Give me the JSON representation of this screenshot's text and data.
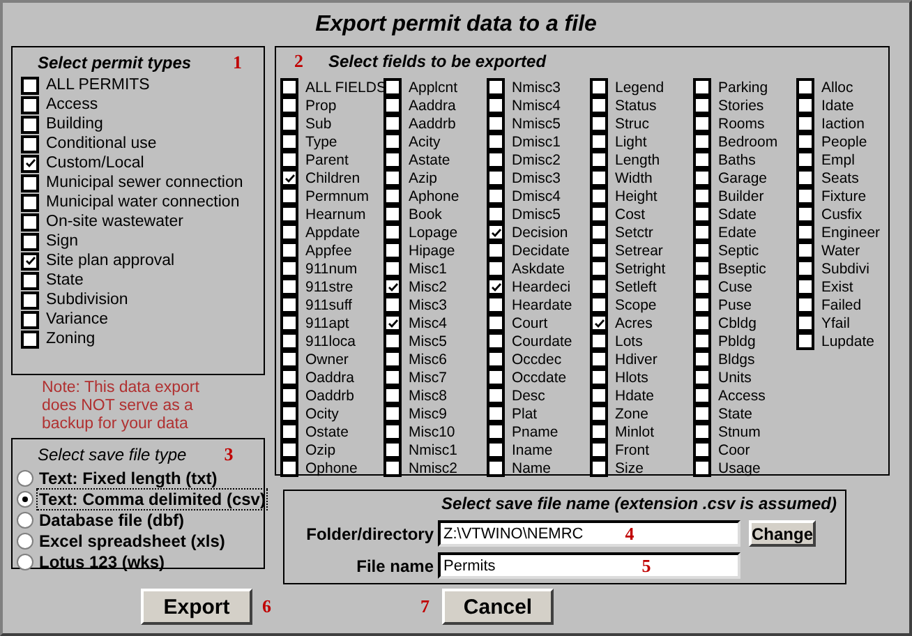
{
  "window": {
    "title": "Export permit data to a file"
  },
  "permit_types": {
    "title": "Select permit types",
    "marker": "1",
    "items": [
      {
        "label": "ALL PERMITS",
        "checked": false
      },
      {
        "label": "Access",
        "checked": false
      },
      {
        "label": "Building",
        "checked": false
      },
      {
        "label": "Conditional use",
        "checked": false
      },
      {
        "label": "Custom/Local",
        "checked": true
      },
      {
        "label": "Municipal sewer connection",
        "checked": false
      },
      {
        "label": "Municipal water connection",
        "checked": false
      },
      {
        "label": "On-site wastewater",
        "checked": false
      },
      {
        "label": "Sign",
        "checked": false
      },
      {
        "label": "Site plan approval",
        "checked": true
      },
      {
        "label": "State",
        "checked": false
      },
      {
        "label": "Subdivision",
        "checked": false
      },
      {
        "label": "Variance",
        "checked": false
      },
      {
        "label": "Zoning",
        "checked": false
      }
    ]
  },
  "note": "Note: This data export does NOT serve as a backup for your data",
  "file_type": {
    "title": "Select save file type",
    "marker": "3",
    "options": [
      {
        "label": "Text: Fixed length (txt)",
        "selected": false,
        "focused": false
      },
      {
        "label": "Text: Comma delimited (csv)",
        "selected": true,
        "focused": true
      },
      {
        "label": "Database file (dbf)",
        "selected": false,
        "focused": false
      },
      {
        "label": "Excel spreadsheet (xls)",
        "selected": false,
        "focused": false
      },
      {
        "label": "Lotus 123 (wks)",
        "selected": false,
        "focused": false
      }
    ]
  },
  "fields": {
    "title": "Select fields to be exported",
    "marker": "2",
    "columns": [
      {
        "items": [
          {
            "label": "ALL FIELDS",
            "checked": false
          },
          {
            "label": "Prop",
            "checked": false
          },
          {
            "label": "Sub",
            "checked": false
          },
          {
            "label": "Type",
            "checked": false
          },
          {
            "label": "Parent",
            "checked": false
          },
          {
            "label": "Children",
            "checked": true
          },
          {
            "label": "Permnum",
            "checked": false
          },
          {
            "label": "Hearnum",
            "checked": false
          },
          {
            "label": "Appdate",
            "checked": false
          },
          {
            "label": "Appfee",
            "checked": false
          },
          {
            "label": "911num",
            "checked": false
          },
          {
            "label": "911stre",
            "checked": false
          },
          {
            "label": "911suff",
            "checked": false
          },
          {
            "label": "911apt",
            "checked": false
          },
          {
            "label": "911loca",
            "checked": false
          },
          {
            "label": "Owner",
            "checked": false
          },
          {
            "label": "Oaddra",
            "checked": false
          },
          {
            "label": "Oaddrb",
            "checked": false
          },
          {
            "label": "Ocity",
            "checked": false
          },
          {
            "label": "Ostate",
            "checked": false
          },
          {
            "label": "Ozip",
            "checked": false
          },
          {
            "label": "Ophone",
            "checked": false
          }
        ]
      },
      {
        "items": [
          {
            "label": "Applcnt",
            "checked": false
          },
          {
            "label": "Aaddra",
            "checked": false
          },
          {
            "label": "Aaddrb",
            "checked": false
          },
          {
            "label": "Acity",
            "checked": false
          },
          {
            "label": "Astate",
            "checked": false
          },
          {
            "label": "Azip",
            "checked": false
          },
          {
            "label": "Aphone",
            "checked": false
          },
          {
            "label": "Book",
            "checked": false
          },
          {
            "label": "Lopage",
            "checked": false
          },
          {
            "label": "Hipage",
            "checked": false
          },
          {
            "label": "Misc1",
            "checked": false
          },
          {
            "label": "Misc2",
            "checked": true
          },
          {
            "label": "Misc3",
            "checked": false
          },
          {
            "label": "Misc4",
            "checked": true
          },
          {
            "label": "Misc5",
            "checked": false
          },
          {
            "label": "Misc6",
            "checked": false
          },
          {
            "label": "Misc7",
            "checked": false
          },
          {
            "label": "Misc8",
            "checked": false
          },
          {
            "label": "Misc9",
            "checked": false
          },
          {
            "label": "Misc10",
            "checked": false
          },
          {
            "label": "Nmisc1",
            "checked": false
          },
          {
            "label": "Nmisc2",
            "checked": false
          }
        ]
      },
      {
        "items": [
          {
            "label": "Nmisc3",
            "checked": false
          },
          {
            "label": "Nmisc4",
            "checked": false
          },
          {
            "label": "Nmisc5",
            "checked": false
          },
          {
            "label": "Dmisc1",
            "checked": false
          },
          {
            "label": "Dmisc2",
            "checked": false
          },
          {
            "label": "Dmisc3",
            "checked": false
          },
          {
            "label": "Dmisc4",
            "checked": false
          },
          {
            "label": "Dmisc5",
            "checked": false
          },
          {
            "label": "Decision",
            "checked": true
          },
          {
            "label": "Decidate",
            "checked": false
          },
          {
            "label": "Askdate",
            "checked": false
          },
          {
            "label": "Heardeci",
            "checked": true
          },
          {
            "label": "Heardate",
            "checked": false
          },
          {
            "label": "Court",
            "checked": false
          },
          {
            "label": "Courdate",
            "checked": false
          },
          {
            "label": "Occdec",
            "checked": false
          },
          {
            "label": "Occdate",
            "checked": false
          },
          {
            "label": "Desc",
            "checked": false
          },
          {
            "label": "Plat",
            "checked": false
          },
          {
            "label": "Pname",
            "checked": false
          },
          {
            "label": "Iname",
            "checked": false
          },
          {
            "label": "Name",
            "checked": false
          }
        ]
      },
      {
        "items": [
          {
            "label": "Legend",
            "checked": false
          },
          {
            "label": "Status",
            "checked": false
          },
          {
            "label": "Struc",
            "checked": false
          },
          {
            "label": "Light",
            "checked": false
          },
          {
            "label": "Length",
            "checked": false
          },
          {
            "label": "Width",
            "checked": false
          },
          {
            "label": "Height",
            "checked": false
          },
          {
            "label": "Cost",
            "checked": false
          },
          {
            "label": "Setctr",
            "checked": false
          },
          {
            "label": "Setrear",
            "checked": false
          },
          {
            "label": "Setright",
            "checked": false
          },
          {
            "label": "Setleft",
            "checked": false
          },
          {
            "label": "Scope",
            "checked": false
          },
          {
            "label": "Acres",
            "checked": true
          },
          {
            "label": "Lots",
            "checked": false
          },
          {
            "label": "Hdiver",
            "checked": false
          },
          {
            "label": "Hlots",
            "checked": false
          },
          {
            "label": "Hdate",
            "checked": false
          },
          {
            "label": "Zone",
            "checked": false
          },
          {
            "label": "Minlot",
            "checked": false
          },
          {
            "label": "Front",
            "checked": false
          },
          {
            "label": "Size",
            "checked": false
          }
        ]
      },
      {
        "items": [
          {
            "label": "Parking",
            "checked": false
          },
          {
            "label": "Stories",
            "checked": false
          },
          {
            "label": "Rooms",
            "checked": false
          },
          {
            "label": "Bedroom",
            "checked": false
          },
          {
            "label": "Baths",
            "checked": false
          },
          {
            "label": "Garage",
            "checked": false
          },
          {
            "label": "Builder",
            "checked": false
          },
          {
            "label": "Sdate",
            "checked": false
          },
          {
            "label": "Edate",
            "checked": false
          },
          {
            "label": "Septic",
            "checked": false
          },
          {
            "label": "Bseptic",
            "checked": false
          },
          {
            "label": "Cuse",
            "checked": false
          },
          {
            "label": "Puse",
            "checked": false
          },
          {
            "label": "Cbldg",
            "checked": false
          },
          {
            "label": "Pbldg",
            "checked": false
          },
          {
            "label": "Bldgs",
            "checked": false
          },
          {
            "label": "Units",
            "checked": false
          },
          {
            "label": "Access",
            "checked": false
          },
          {
            "label": "State",
            "checked": false
          },
          {
            "label": "Stnum",
            "checked": false
          },
          {
            "label": "Coor",
            "checked": false
          },
          {
            "label": "Usage",
            "checked": false
          }
        ]
      },
      {
        "items": [
          {
            "label": "Alloc",
            "checked": false
          },
          {
            "label": "Idate",
            "checked": false
          },
          {
            "label": "Iaction",
            "checked": false
          },
          {
            "label": "People",
            "checked": false
          },
          {
            "label": "Empl",
            "checked": false
          },
          {
            "label": "Seats",
            "checked": false
          },
          {
            "label": "Fixture",
            "checked": false
          },
          {
            "label": "Cusfix",
            "checked": false
          },
          {
            "label": "Engineer",
            "checked": false
          },
          {
            "label": "Water",
            "checked": false
          },
          {
            "label": "Subdivi",
            "checked": false
          },
          {
            "label": "Exist",
            "checked": false
          },
          {
            "label": "Failed",
            "checked": false
          },
          {
            "label": "Yfail",
            "checked": false
          },
          {
            "label": "Lupdate",
            "checked": false
          }
        ]
      }
    ]
  },
  "save_name": {
    "title": "Select save file name (extension .csv is assumed)",
    "folder": {
      "label": "Folder/directory",
      "value": "Z:\\VTWINO\\NEMRC",
      "marker": "4"
    },
    "change_button": "Change",
    "file": {
      "label": "File name",
      "value": "Permits",
      "marker": "5"
    }
  },
  "export_button": {
    "label": "Export",
    "marker": "6"
  },
  "cancel_button": {
    "label": "Cancel",
    "marker": "7"
  }
}
